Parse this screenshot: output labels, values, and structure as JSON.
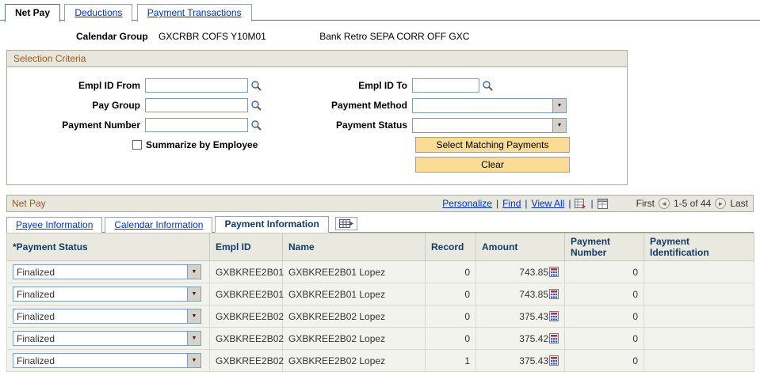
{
  "colors": {
    "accent": "#9C5A21",
    "link": "#0033CC",
    "btn-bg": "#FBDC94",
    "hdr-text": "#123A6B"
  },
  "icons": {
    "dropdown_arrow": "▼",
    "prev_arrow": "◄",
    "next_arrow": "►",
    "lookup": "magnifier",
    "calculator": "calculator",
    "download_grid": "download-grid",
    "zoom_grid": "zoom-grid",
    "show_all_columns": "show-all-columns-grid"
  },
  "page_tabs": [
    {
      "label": "Net Pay",
      "active": true
    },
    {
      "label": "Deductions",
      "active": false
    },
    {
      "label": "Payment Transactions",
      "active": false
    }
  ],
  "header": {
    "calendar_group_label": "Calendar Group",
    "calendar_group_value": "GXCRBR COFS Y10M01",
    "bank_retro_value": "Bank Retro SEPA CORR OFF GXC"
  },
  "selection": {
    "title": "Selection Criteria",
    "labels": {
      "empl_id_from": "Empl ID From",
      "empl_id_to": "Empl ID To",
      "pay_group": "Pay Group",
      "payment_method": "Payment Method",
      "payment_number": "Payment Number",
      "payment_status": "Payment Status"
    },
    "values": {
      "empl_id_from": "",
      "empl_id_to": "",
      "pay_group": "",
      "payment_method": "",
      "payment_number": "",
      "payment_status": ""
    },
    "checkbox_label": "Summarize by Employee",
    "checkbox_checked": false,
    "buttons": {
      "select_matching": "Select Matching Payments",
      "clear": "Clear"
    }
  },
  "grid": {
    "title": "Net Pay",
    "toolbar": {
      "personalize": "Personalize",
      "find": "Find",
      "view_all": "View All",
      "pipe": "|",
      "first": "First",
      "range": "1-5 of 44",
      "last": "Last"
    },
    "tabs": [
      {
        "label": "Payee Information",
        "active": false
      },
      {
        "label": "Calendar Information",
        "active": false
      },
      {
        "label": "Payment Information",
        "active": true
      }
    ],
    "columns": [
      "*Payment Status",
      "Empl ID",
      "Name",
      "Record",
      "Amount",
      "Payment Number",
      "Payment Identification"
    ],
    "rows": [
      {
        "status": "Finalized",
        "empl_id": "GXBKREE2B01",
        "name": "GXBKREE2B01 Lopez",
        "record": "0",
        "amount": "743.85",
        "payment_number": "0",
        "payment_identification": ""
      },
      {
        "status": "Finalized",
        "empl_id": "GXBKREE2B01",
        "name": "GXBKREE2B01 Lopez",
        "record": "0",
        "amount": "743.85",
        "payment_number": "0",
        "payment_identification": ""
      },
      {
        "status": "Finalized",
        "empl_id": "GXBKREE2B02",
        "name": "GXBKREE2B02 Lopez",
        "record": "0",
        "amount": "375.43",
        "payment_number": "0",
        "payment_identification": ""
      },
      {
        "status": "Finalized",
        "empl_id": "GXBKREE2B02",
        "name": "GXBKREE2B02 Lopez",
        "record": "0",
        "amount": "375.42",
        "payment_number": "0",
        "payment_identification": ""
      },
      {
        "status": "Finalized",
        "empl_id": "GXBKREE2B02",
        "name": "GXBKREE2B02 Lopez",
        "record": "1",
        "amount": "375.43",
        "payment_number": "0",
        "payment_identification": ""
      }
    ]
  }
}
